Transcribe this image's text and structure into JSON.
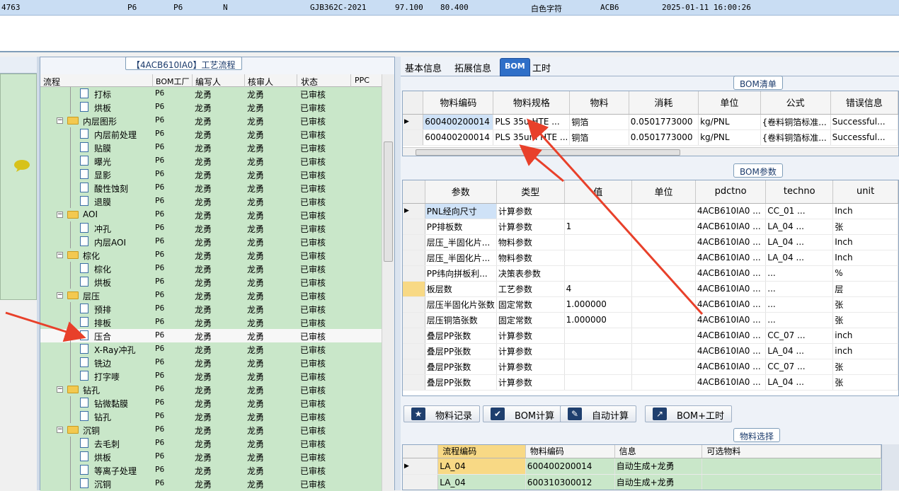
{
  "topbar": {
    "cells": [
      "4763",
      "P6",
      "P6",
      "N",
      "GJB362C-2021",
      "97.100",
      "80.400",
      "白色字符",
      "ACB6",
      "2025-01-11 16:00:26"
    ]
  },
  "flow": {
    "title": "【4ACB610IA0】工艺流程",
    "headers": {
      "flow": "流程",
      "bom_factory": "BOM工厂",
      "writer": "编写人",
      "reviewer": "核审人",
      "status": "状态",
      "ppc": "PPC"
    },
    "rows": [
      {
        "name": "打标",
        "type": "doc",
        "bom": "P6",
        "writer": "龙勇",
        "reviewer": "龙勇",
        "status": "已审核"
      },
      {
        "name": "烘板",
        "type": "doc",
        "bom": "P6",
        "writer": "龙勇",
        "reviewer": "龙勇",
        "status": "已审核"
      },
      {
        "name": "内层图形",
        "type": "folder",
        "bom": "P6",
        "writer": "龙勇",
        "reviewer": "龙勇",
        "status": "已审核"
      },
      {
        "name": "内层前处理",
        "type": "doc",
        "bom": "P6",
        "writer": "龙勇",
        "reviewer": "龙勇",
        "status": "已审核"
      },
      {
        "name": "贴膜",
        "type": "doc",
        "bom": "P6",
        "writer": "龙勇",
        "reviewer": "龙勇",
        "status": "已审核"
      },
      {
        "name": "曝光",
        "type": "doc",
        "bom": "P6",
        "writer": "龙勇",
        "reviewer": "龙勇",
        "status": "已审核"
      },
      {
        "name": "显影",
        "type": "doc",
        "bom": "P6",
        "writer": "龙勇",
        "reviewer": "龙勇",
        "status": "已审核"
      },
      {
        "name": "酸性蚀刻",
        "type": "doc",
        "bom": "P6",
        "writer": "龙勇",
        "reviewer": "龙勇",
        "status": "已审核"
      },
      {
        "name": "退膜",
        "type": "doc",
        "bom": "P6",
        "writer": "龙勇",
        "reviewer": "龙勇",
        "status": "已审核"
      },
      {
        "name": "AOI",
        "type": "folder",
        "bom": "P6",
        "writer": "龙勇",
        "reviewer": "龙勇",
        "status": "已审核"
      },
      {
        "name": "冲孔",
        "type": "doc",
        "bom": "P6",
        "writer": "龙勇",
        "reviewer": "龙勇",
        "status": "已审核"
      },
      {
        "name": "内层AOI",
        "type": "doc",
        "bom": "P6",
        "writer": "龙勇",
        "reviewer": "龙勇",
        "status": "已审核"
      },
      {
        "name": "棕化",
        "type": "folder",
        "bom": "P6",
        "writer": "龙勇",
        "reviewer": "龙勇",
        "status": "已审核"
      },
      {
        "name": "棕化",
        "type": "doc",
        "bom": "P6",
        "writer": "龙勇",
        "reviewer": "龙勇",
        "status": "已审核"
      },
      {
        "name": "烘板",
        "type": "doc",
        "bom": "P6",
        "writer": "龙勇",
        "reviewer": "龙勇",
        "status": "已审核"
      },
      {
        "name": "层压",
        "type": "folder",
        "bom": "P6",
        "writer": "龙勇",
        "reviewer": "龙勇",
        "status": "已审核"
      },
      {
        "name": "预排",
        "type": "doc",
        "bom": "P6",
        "writer": "龙勇",
        "reviewer": "龙勇",
        "status": "已审核"
      },
      {
        "name": "排板",
        "type": "doc",
        "bom": "P6",
        "writer": "龙勇",
        "reviewer": "龙勇",
        "status": "已审核"
      },
      {
        "name": "压合",
        "type": "doc",
        "bom": "P6",
        "writer": "龙勇",
        "reviewer": "龙勇",
        "status": "已审核",
        "selected": true
      },
      {
        "name": "X-Ray冲孔",
        "type": "doc",
        "bom": "P6",
        "writer": "龙勇",
        "reviewer": "龙勇",
        "status": "已审核"
      },
      {
        "name": "铣边",
        "type": "doc",
        "bom": "P6",
        "writer": "龙勇",
        "reviewer": "龙勇",
        "status": "已审核"
      },
      {
        "name": "打字嘜",
        "type": "doc",
        "bom": "P6",
        "writer": "龙勇",
        "reviewer": "龙勇",
        "status": "已审核"
      },
      {
        "name": "钻孔",
        "type": "folder",
        "bom": "P6",
        "writer": "龙勇",
        "reviewer": "龙勇",
        "status": "已审核"
      },
      {
        "name": "钻微黏膜",
        "type": "doc",
        "bom": "P6",
        "writer": "龙勇",
        "reviewer": "龙勇",
        "status": "已审核"
      },
      {
        "name": "钻孔",
        "type": "doc",
        "bom": "P6",
        "writer": "龙勇",
        "reviewer": "龙勇",
        "status": "已审核"
      },
      {
        "name": "沉铜",
        "type": "folder",
        "bom": "P6",
        "writer": "龙勇",
        "reviewer": "龙勇",
        "status": "已审核"
      },
      {
        "name": "去毛刺",
        "type": "doc",
        "bom": "P6",
        "writer": "龙勇",
        "reviewer": "龙勇",
        "status": "已审核"
      },
      {
        "name": "烘板",
        "type": "doc",
        "bom": "P6",
        "writer": "龙勇",
        "reviewer": "龙勇",
        "status": "已审核"
      },
      {
        "name": "等离子处理",
        "type": "doc",
        "bom": "P6",
        "writer": "龙勇",
        "reviewer": "龙勇",
        "status": "已审核"
      },
      {
        "name": "沉铜",
        "type": "doc",
        "bom": "P6",
        "writer": "龙勇",
        "reviewer": "龙勇",
        "status": "已审核"
      }
    ]
  },
  "tabs": [
    "基本信息",
    "拓展信息",
    "BOM",
    "工时"
  ],
  "bom_list": {
    "title": "BOM清单",
    "headers": [
      "物料编码",
      "物料规格",
      "物料",
      "消耗",
      "单位",
      "公式",
      "错误信息"
    ],
    "rows": [
      [
        "600400200014",
        "PLS 35u HTE ...",
        "铜箔",
        "0.0501773000",
        "kg/PNL",
        "{卷料铜箔标准...",
        "Successful..."
      ],
      [
        "600400200014",
        "PLS 35um HTE ...",
        "铜箔",
        "0.0501773000",
        "kg/PNL",
        "{卷料铜箔标准...",
        "Successful..."
      ]
    ]
  },
  "bom_params": {
    "title": "BOM参数",
    "headers": [
      "参数",
      "类型",
      "值",
      "单位",
      "pdctno",
      "techno",
      "unit"
    ],
    "rows": [
      [
        "PNL经向尺寸",
        "计算参数",
        "",
        "",
        "4ACB610IA0 ...",
        "CC_01 ...",
        "Inch"
      ],
      [
        "PP排板数",
        "计算参数",
        "1",
        "",
        "4ACB610IA0 ...",
        "LA_04 ...",
        "张"
      ],
      [
        "层压_半固化片...",
        "物料参数",
        "",
        "",
        "4ACB610IA0 ...",
        "LA_04 ...",
        "Inch"
      ],
      [
        "层压_半固化片...",
        "物料参数",
        "",
        "",
        "4ACB610IA0 ...",
        "LA_04 ...",
        "Inch"
      ],
      [
        "PP纬向拼板利...",
        "决策表参数",
        "",
        "",
        "4ACB610IA0 ...",
        "...",
        "%"
      ],
      [
        "板层数",
        "工艺参数",
        "4",
        "",
        "4ACB610IA0 ...",
        "...",
        "层"
      ],
      [
        "层压半固化片张数",
        "固定常数",
        "1.000000",
        "",
        "4ACB610IA0 ...",
        "...",
        "张"
      ],
      [
        "层压铜箔张数",
        "固定常数",
        "1.000000",
        "",
        "4ACB610IA0 ...",
        "...",
        "张"
      ],
      [
        "叠层PP张数",
        "计算参数",
        "",
        "",
        "4ACB610IA0 ...",
        "CC_07 ...",
        "inch"
      ],
      [
        "叠层PP张数",
        "计算参数",
        "",
        "",
        "4ACB610IA0 ...",
        "LA_04 ...",
        "inch"
      ],
      [
        "叠层PP张数",
        "计算参数",
        "",
        "",
        "4ACB610IA0 ...",
        "CC_07 ...",
        "张"
      ],
      [
        "叠层PP张数",
        "计算参数",
        "",
        "",
        "4ACB610IA0 ...",
        "LA_04 ...",
        "张"
      ]
    ]
  },
  "toolbar": {
    "material_record": "物料记录",
    "bom_calc": "BOM计算",
    "auto_calc": "自动计算",
    "bom_hours": "BOM+工时"
  },
  "material_select": {
    "title": "物料选择",
    "headers": [
      "流程编码",
      "物料编码",
      "信息",
      "可选物料"
    ],
    "rows": [
      [
        "LA_04",
        "600400200014",
        "自动生成+龙勇",
        ""
      ],
      [
        "LA_04",
        "600310300012",
        "自动生成+龙勇",
        ""
      ]
    ]
  },
  "colors": {
    "accent": "#2f6fc8",
    "row_green": "#c9e7c9",
    "arrow": "#e8402a"
  }
}
